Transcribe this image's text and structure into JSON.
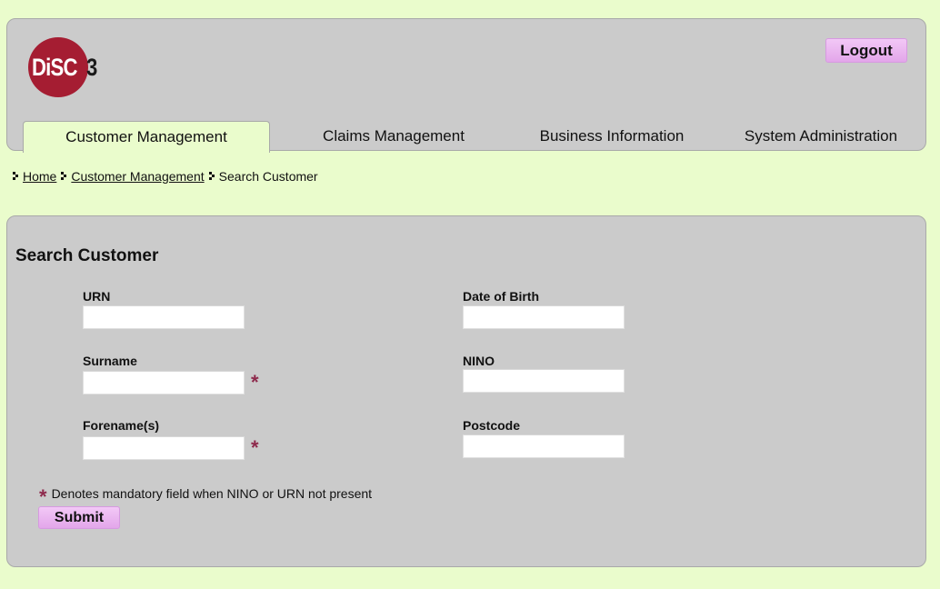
{
  "app": {
    "logo_text": "DiSC",
    "logo_number": "3",
    "brand_color": "#a51d32"
  },
  "header": {
    "logout_label": "Logout"
  },
  "tabs": [
    {
      "label": "Customer Management",
      "active": true
    },
    {
      "label": "Claims Management",
      "active": false
    },
    {
      "label": "Business Information",
      "active": false
    },
    {
      "label": "System Administration",
      "active": false
    }
  ],
  "breadcrumb": {
    "items": [
      "Home",
      "Customer Management",
      "Search Customer"
    ]
  },
  "form": {
    "title": "Search Customer",
    "fields": {
      "urn": {
        "label": "URN",
        "value": ""
      },
      "surname": {
        "label": "Surname",
        "value": ""
      },
      "forenames": {
        "label": "Forename(s)",
        "value": ""
      },
      "dob": {
        "label": "Date of Birth",
        "value": ""
      },
      "nino": {
        "label": "NINO",
        "value": ""
      },
      "postcode": {
        "label": "Postcode",
        "value": ""
      }
    },
    "required_marker": "*",
    "mandatory_note": "Denotes mandatory field when NINO or URN not present",
    "submit_label": "Submit"
  },
  "colors": {
    "page_background": "#eafccc",
    "panel_background": "#cbcbcb",
    "button_background": "#e8b3ee",
    "required_star": "#8e2a4c"
  }
}
